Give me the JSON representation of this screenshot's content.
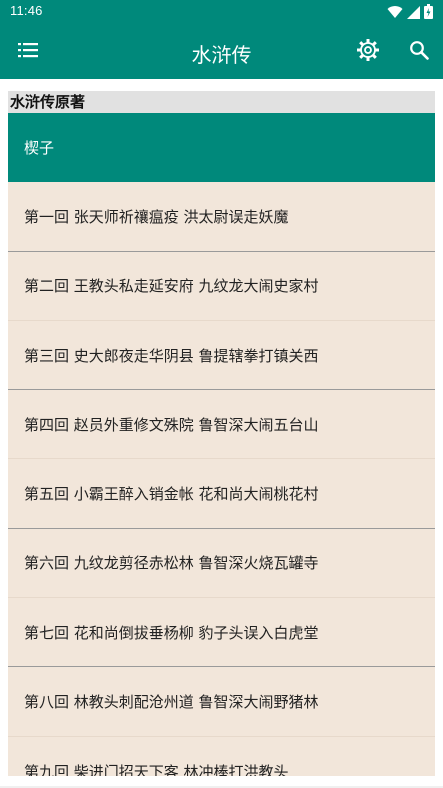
{
  "status_bar": {
    "time": "11:46",
    "icons": [
      "wifi-icon",
      "signal-icon",
      "battery-icon"
    ]
  },
  "app_bar": {
    "title": "水浒传",
    "menu_icon": "menu-icon",
    "settings_icon": "gear-icon",
    "search_icon": "search-icon"
  },
  "colors": {
    "primary": "#00897b",
    "list_background": "#f2e6da",
    "section_header_bg": "#e1e1e1"
  },
  "list": {
    "section_title": "水浒传原著",
    "items": [
      "楔子",
      "第一回 张天师祈禳瘟疫 洪太尉误走妖魔",
      "第二回 王教头私走延安府 九纹龙大闹史家村",
      "第三回 史大郎夜走华阴县 鲁提辖拳打镇关西",
      "第四回 赵员外重修文殊院 鲁智深大闹五台山",
      "第五回 小霸王醉入销金帐 花和尚大闹桃花村",
      "第六回 九纹龙剪径赤松林 鲁智深火烧瓦罐寺",
      "第七回 花和尚倒拔垂杨柳 豹子头误入白虎堂",
      "第八回 林教头刺配沧州道 鲁智深大闹野猪林",
      "第九回 柴进门招天下客 林冲棒打洪教头"
    ]
  }
}
